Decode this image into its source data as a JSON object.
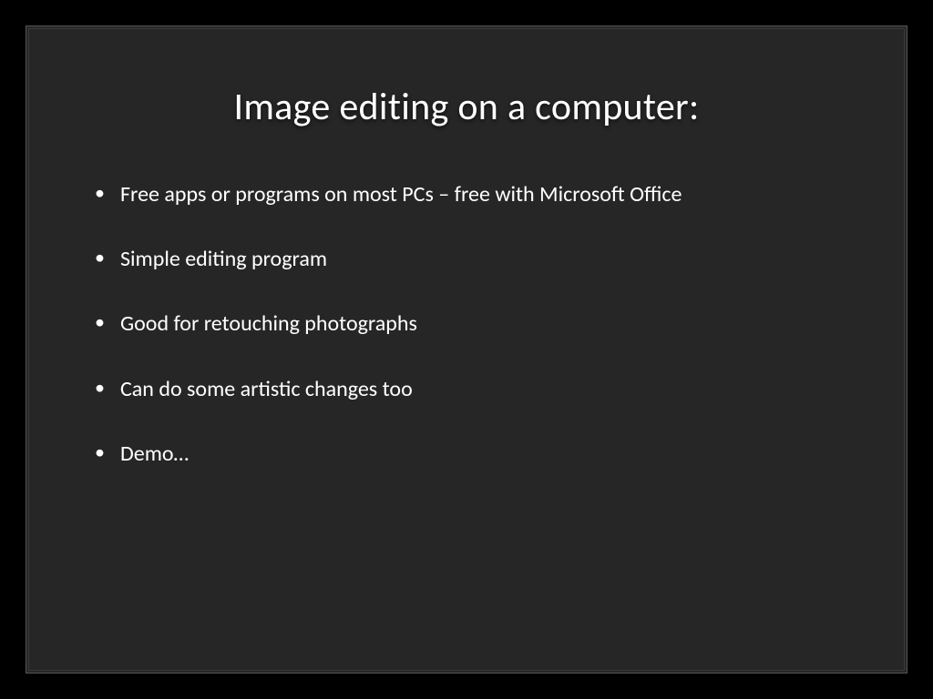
{
  "slide": {
    "title": "Image editing on a computer:",
    "bullets": [
      "Free apps or programs on most PCs – free with Microsoft Office",
      "Simple editing program",
      "Good for retouching photographs",
      "Can do some artistic changes too",
      "Demo…"
    ]
  }
}
